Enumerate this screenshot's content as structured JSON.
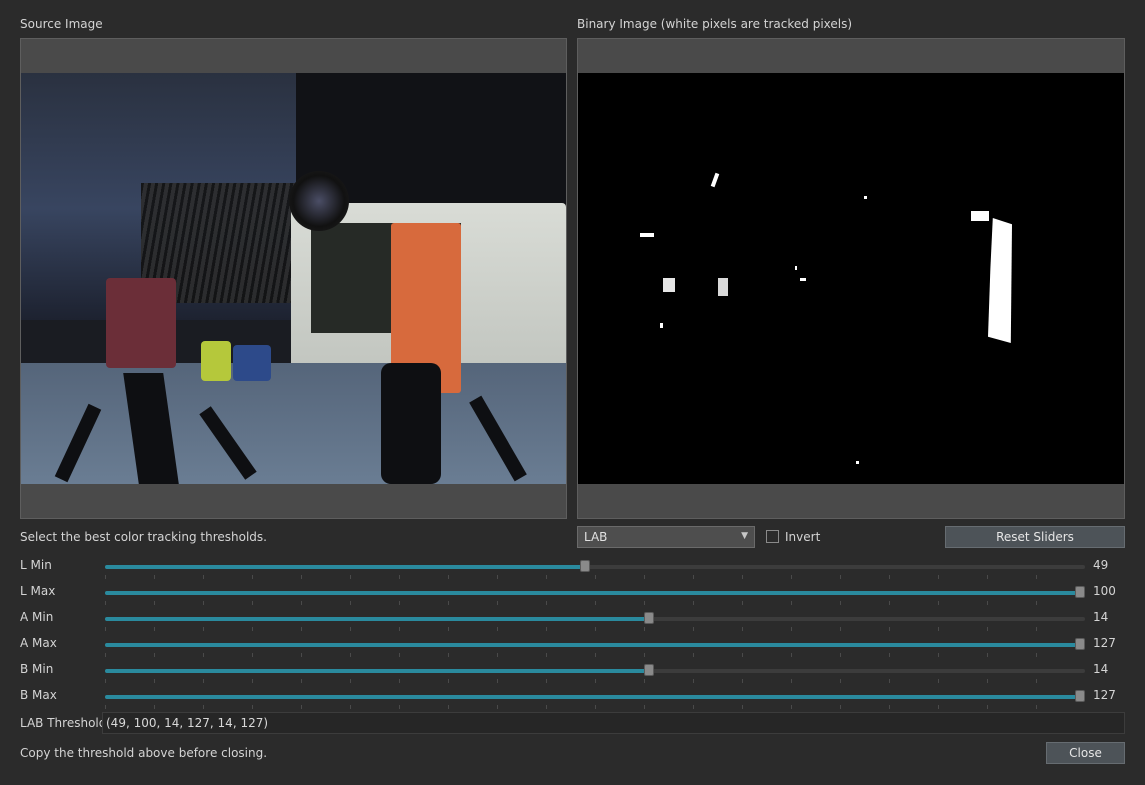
{
  "source_panel": {
    "title": "Source Image"
  },
  "binary_panel": {
    "title": "Binary Image (white pixels are tracked pixels)"
  },
  "instructions": "Select the best color tracking thresholds.",
  "color_space_select": {
    "value": "LAB"
  },
  "invert": {
    "label": "Invert",
    "checked": false
  },
  "reset_button": {
    "label": "Reset Sliders"
  },
  "sliders": [
    {
      "label": "L Min",
      "value": "49",
      "fraction": 0.49
    },
    {
      "label": "L Max",
      "value": "100",
      "fraction": 1.0
    },
    {
      "label": "A Min",
      "value": "14",
      "fraction": 0.555
    },
    {
      "label": "A Max",
      "value": "127",
      "fraction": 1.0
    },
    {
      "label": "B Min",
      "value": "14",
      "fraction": 0.555
    },
    {
      "label": "B Max",
      "value": "127",
      "fraction": 1.0
    }
  ],
  "threshold": {
    "label": "LAB Threshold",
    "value": "(49, 100, 14, 127, 14, 127)"
  },
  "footer": {
    "note": "Copy the threshold above before closing.",
    "close_label": "Close"
  },
  "colors": {
    "slider_fill": "#2a8a9e",
    "background": "#2b2b2b"
  }
}
